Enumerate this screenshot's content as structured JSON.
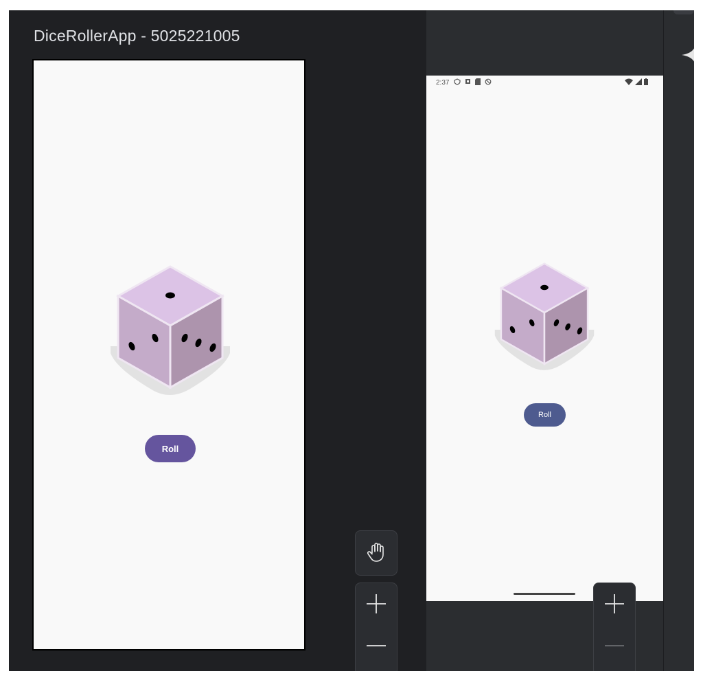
{
  "preview": {
    "title": "DiceRollerApp - 5025221005",
    "roll_label": "Roll",
    "roll_color": "#65559e"
  },
  "tools": {
    "pan_icon": "hand-icon",
    "zoom_in_icon": "plus-icon",
    "zoom_out_icon": "minus-icon"
  },
  "device": {
    "status_time": "2:37",
    "roll_label": "Roll",
    "roll_color": "#4e5b8f"
  },
  "dice": {
    "top_pips": 1,
    "left_pips": 2,
    "right_pips": 3,
    "face_color": "#c8b2d6"
  }
}
